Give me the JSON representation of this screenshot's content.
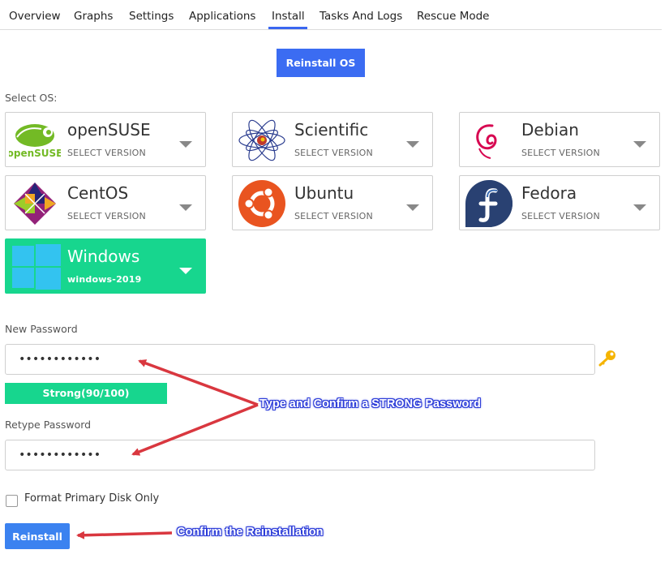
{
  "tabs": [
    "Overview",
    "Graphs",
    "Settings",
    "Applications",
    "Install",
    "Tasks And Logs",
    "Rescue Mode"
  ],
  "active_tab": "Install",
  "reinstall_os_button": "Reinstall OS",
  "select_os_label": "Select OS:",
  "os_options": [
    {
      "name": "openSUSE",
      "version": "SELECT VERSION",
      "icon": "opensuse-logo"
    },
    {
      "name": "Scientific",
      "version": "SELECT VERSION",
      "icon": "scientific-linux-logo"
    },
    {
      "name": "Debian",
      "version": "SELECT VERSION",
      "icon": "debian-logo"
    },
    {
      "name": "CentOS",
      "version": "SELECT VERSION",
      "icon": "centos-logo"
    },
    {
      "name": "Ubuntu",
      "version": "SELECT VERSION",
      "icon": "ubuntu-logo"
    },
    {
      "name": "Fedora",
      "version": "SELECT VERSION",
      "icon": "fedora-logo"
    },
    {
      "name": "Windows",
      "version": "windows-2019",
      "icon": "windows-logo",
      "selected": true
    }
  ],
  "opensuse_logo_text": "openSUSE",
  "new_password": {
    "label": "New Password",
    "value": "••••••••••••"
  },
  "strength": "Strong(90/100)",
  "retype_password": {
    "label": "Retype Password",
    "value": "••••••••••••"
  },
  "format_disk_label": "Format Primary Disk Only",
  "reinstall_button": "Reinstall",
  "annotations": {
    "password_note": "Type and Confirm a STRONG Password",
    "confirm_note": "Confirm the Reinstallation"
  },
  "colors": {
    "accent": "#3b6cf2",
    "selected_os": "#17d68e",
    "annotation_arrow": "#d9373f",
    "annotation_text_outline": "#2b3bd8"
  }
}
